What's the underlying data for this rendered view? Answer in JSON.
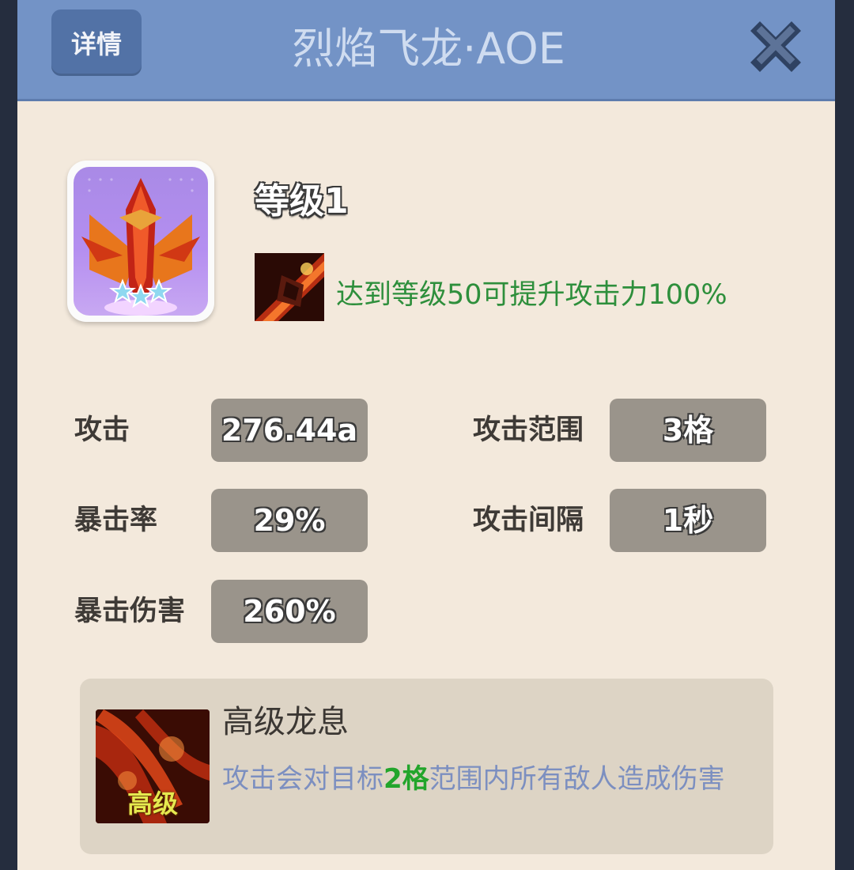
{
  "header": {
    "detail_label": "详情",
    "title": "烈焰飞龙·AOE",
    "close_icon": "close-x-icon"
  },
  "tower": {
    "icon": "fire-dragon-tower-icon",
    "level_text": "等级1",
    "bonus_icon": "fire-claw-icon",
    "bonus_text": "达到等级50可提升攻击力100%"
  },
  "stats": [
    {
      "label": "攻击",
      "value": "276.44a"
    },
    {
      "label": "攻击范围",
      "value": "3格"
    },
    {
      "label": "暴击率",
      "value": "29%"
    },
    {
      "label": "攻击间隔",
      "value": "1秒"
    },
    {
      "label": "暴击伤害",
      "value": "260%"
    }
  ],
  "skill": {
    "icon": "dragon-breath-skill-icon",
    "tag": "高级",
    "name": "高级龙息",
    "desc_prefix": "攻击会对目标",
    "desc_highlight": "2格",
    "desc_suffix": "范围内所有敌人造成伤害"
  },
  "colors": {
    "header": "#7393c6",
    "panel": "#f3e9dc",
    "bonus_text": "#2e8f3c",
    "skill_desc": "#7c8fc0",
    "highlight": "#22a52b",
    "stat_box": "#9a948b"
  }
}
